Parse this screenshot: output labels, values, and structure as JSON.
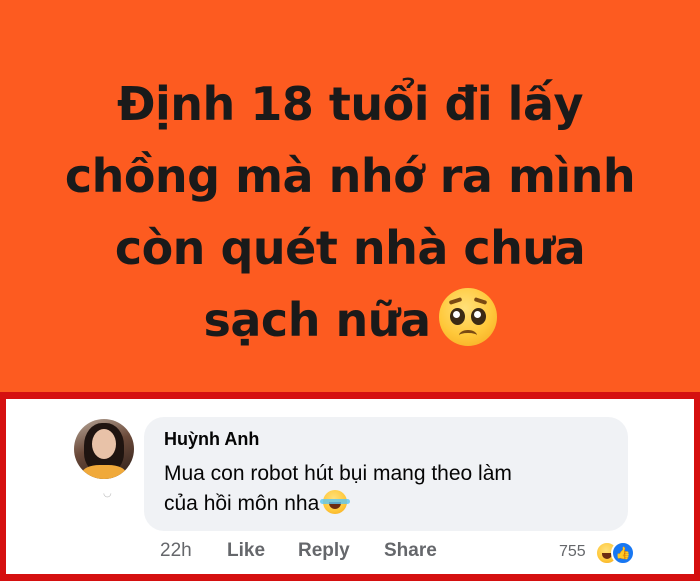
{
  "post": {
    "line1": "Định 18 tuổi đi lấy",
    "line2": "chồng mà nhớ ra mình",
    "line3": "còn quét nhà chưa",
    "line4": "sạch nữa",
    "emoji": "pleading-face-icon",
    "background_color": "#fd5b20"
  },
  "comment": {
    "author": "Huỳnh Anh",
    "text_line1": "Mua con robot hút bụi mang theo làm",
    "text_line2": "của hồi môn nha",
    "emoji": "rolling-laughing-icon",
    "timestamp": "22h",
    "like_label": "Like",
    "reply_label": "Reply",
    "share_label": "Share",
    "reaction_count": "755",
    "reaction_icons": [
      "haha-reaction-icon",
      "like-reaction-icon"
    ],
    "frame_color": "#d51010"
  }
}
